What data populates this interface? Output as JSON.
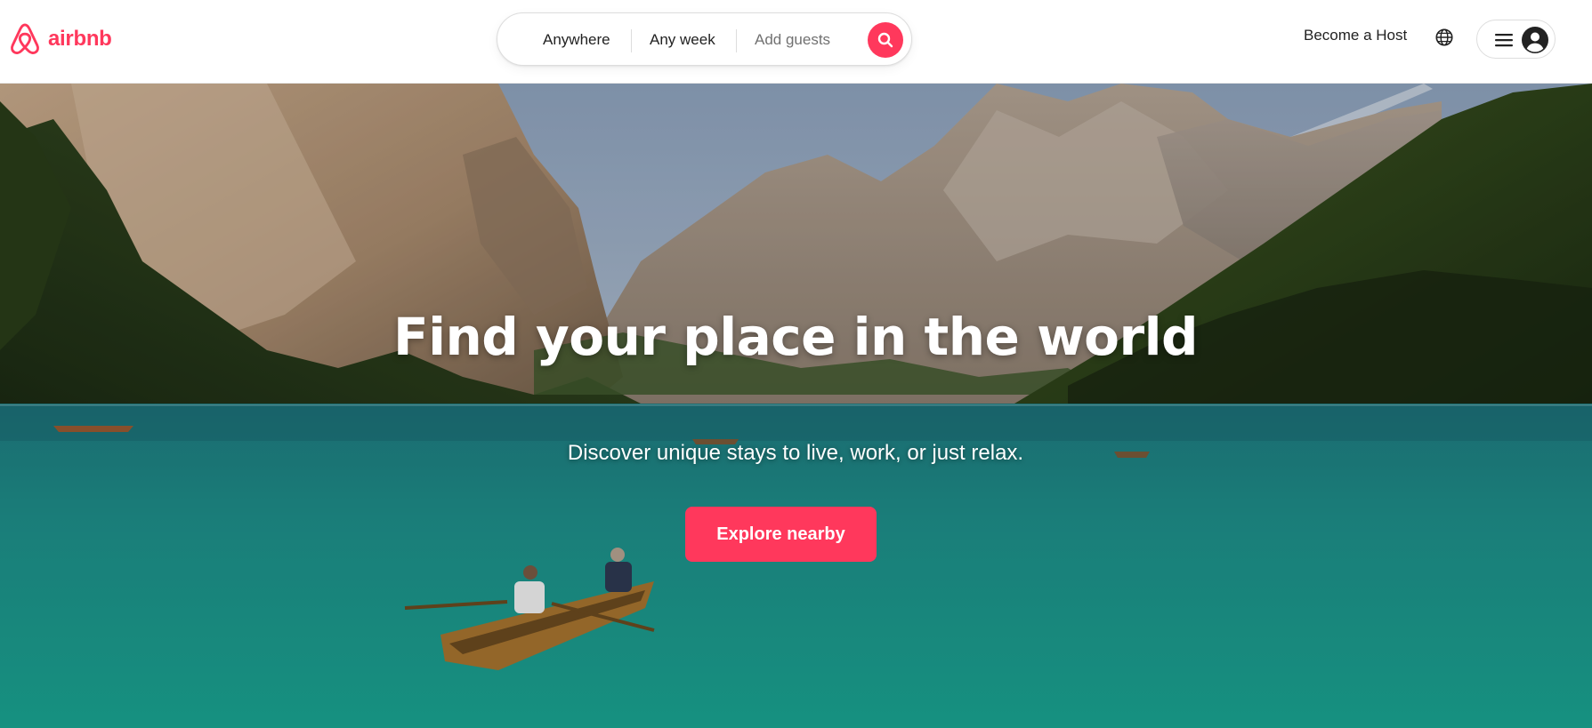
{
  "brand": {
    "name": "airbnb",
    "accent_color": "#ff385c"
  },
  "search": {
    "location_label": "Anywhere",
    "dates_label": "Any week",
    "guests_placeholder": "Add guests",
    "search_icon": "search-icon"
  },
  "nav": {
    "host_label": "Become a Host",
    "language_icon": "globe-icon",
    "menu_icon": "hamburger-menu-icon",
    "profile_icon": "user-avatar-icon"
  },
  "hero": {
    "title": "Find your place in the world",
    "subtitle": "Discover unique stays to live, work, or just relax.",
    "cta_label": "Explore nearby",
    "image_description_icon": "lake-mountains-photo"
  }
}
